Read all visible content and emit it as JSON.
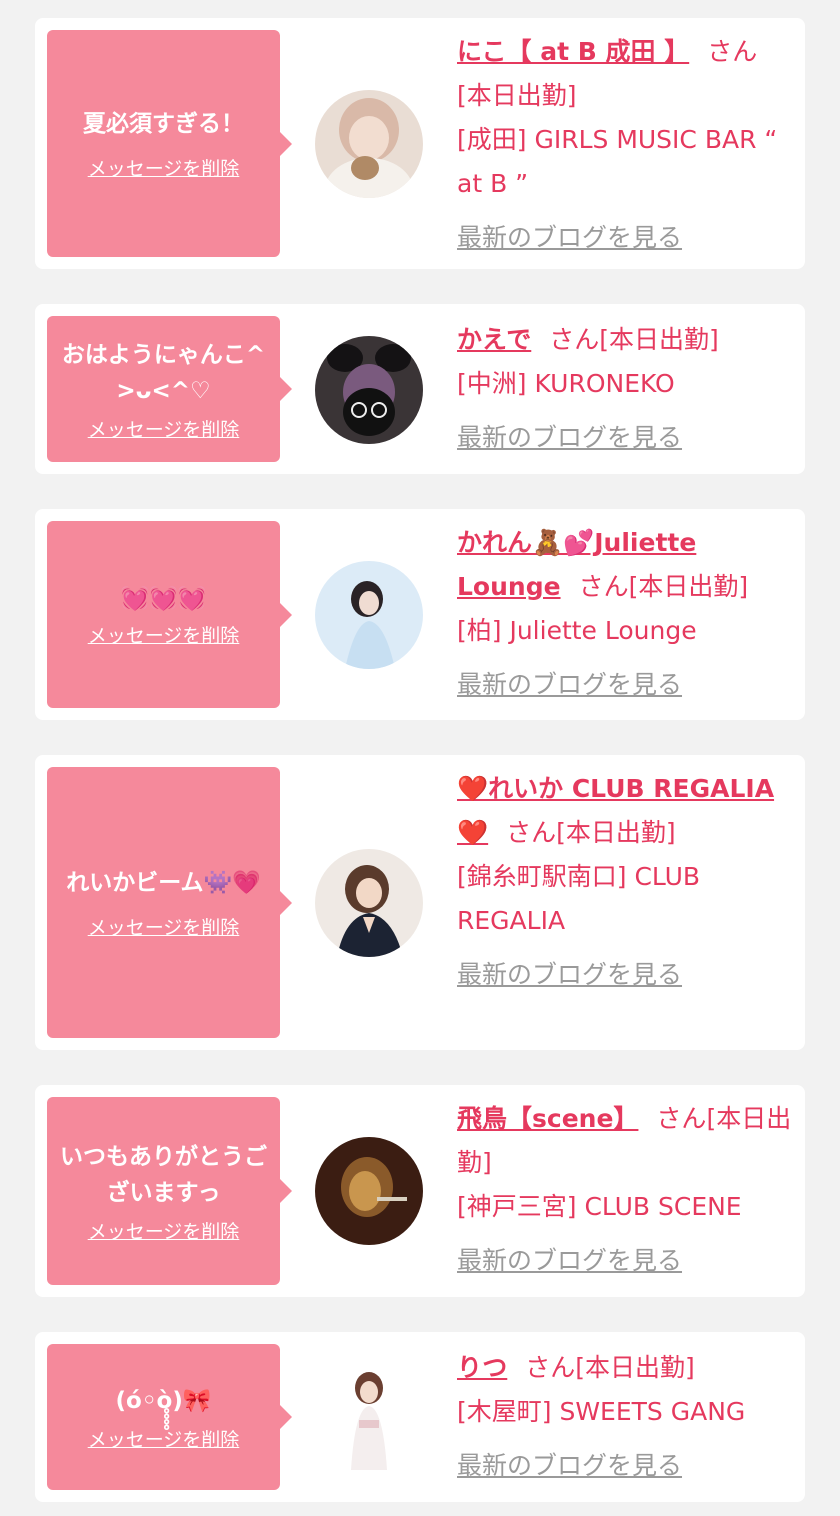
{
  "delete_label": "メッセージを削除",
  "blog_label": "最新のブログを見る",
  "san_label": "さん",
  "cards": [
    {
      "message": "夏必須すぎる！",
      "name": "にこ【 at B 成田 】",
      "status": "[本日出勤]",
      "shop": "[成田] GIRLS MUSIC BAR “ at B ”"
    },
    {
      "message": "おはようにゃんこ^ >ᴗ<^♡",
      "name": "かえで",
      "status": "[本日出勤]",
      "shop": "[中洲] KURONEKO"
    },
    {
      "message": "💓💓💓",
      "name": "かれん🧸💕Juliette Lounge",
      "status": "[本日出勤]",
      "shop": "[柏] Juliette Lounge"
    },
    {
      "message": "れいかビーム👾💗",
      "name": "❤️れいか CLUB REGALIA❤️",
      "status": "[本日出勤]",
      "shop": "[錦糸町駅南口] CLUB REGALIA"
    },
    {
      "message": "いつもありがとうございますっ",
      "name": "飛鳥【scene】",
      "status": "[本日出勤]",
      "shop": "[神戸三宮] CLUB SCENE"
    },
    {
      "message": "(ó◦ò̥̥̥̥)🎀",
      "name": "りつ",
      "status": "[本日出勤]",
      "shop": "[木屋町] SWEETS GANG"
    }
  ]
}
